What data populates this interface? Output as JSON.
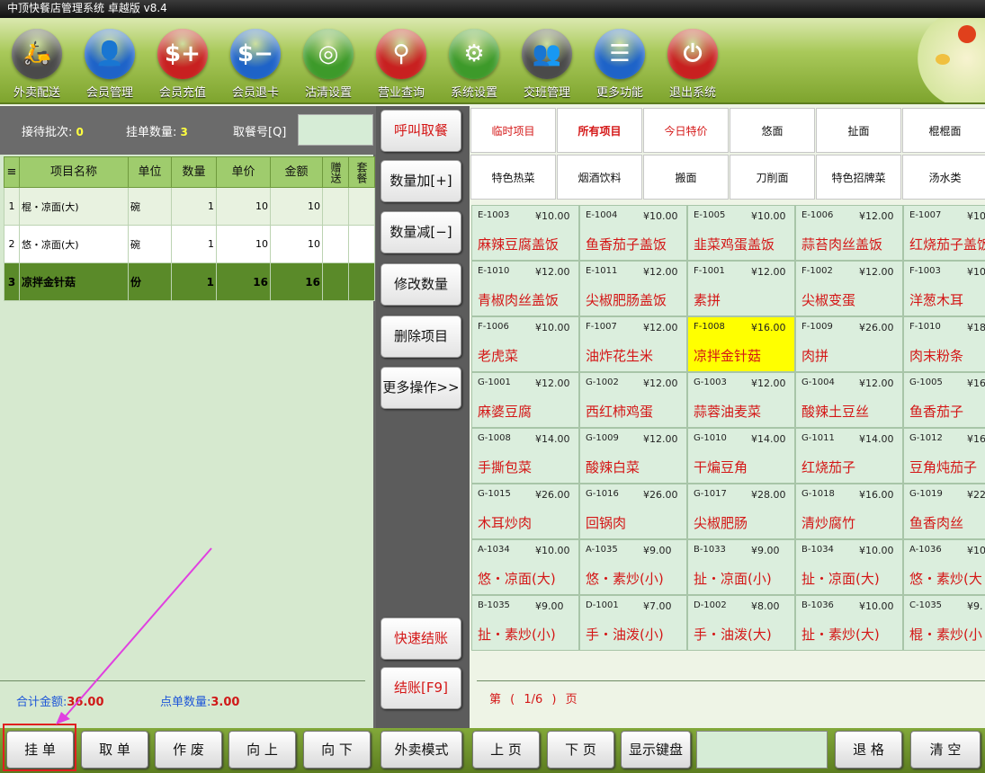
{
  "app": {
    "title": "中顶快餐店管理系统 卓越版 v8.4"
  },
  "toolbar": [
    {
      "label": "外卖配送",
      "icon": "scooter-icon",
      "glyph": "🛵",
      "color": "#4a4a4a"
    },
    {
      "label": "会员管理",
      "icon": "member-icon",
      "glyph": "👤",
      "color": "#1e63c8"
    },
    {
      "label": "会员充值",
      "icon": "recharge-card-icon",
      "glyph": "$+",
      "color": "#c82020"
    },
    {
      "label": "会员退卡",
      "icon": "refund-card-icon",
      "glyph": "$−",
      "color": "#1e63c8"
    },
    {
      "label": "沽清设置",
      "icon": "plate-icon",
      "glyph": "◎",
      "color": "#3d9a2a"
    },
    {
      "label": "营业查询",
      "icon": "magnifier-icon",
      "glyph": "⚲",
      "color": "#c82020"
    },
    {
      "label": "系统设置",
      "icon": "gear-icon",
      "glyph": "⚙",
      "color": "#3d9a2a"
    },
    {
      "label": "交班管理",
      "icon": "handover-icon",
      "glyph": "👥",
      "color": "#4a4a4a"
    },
    {
      "label": "更多功能",
      "icon": "list-icon",
      "glyph": "☰",
      "color": "#1e63c8"
    },
    {
      "label": "退出系统",
      "icon": "power-icon",
      "glyph": "⏻",
      "color": "#c82020"
    }
  ],
  "order": {
    "waiting_label": "接待批次:",
    "waiting_value": "0",
    "hold_label": "挂单数量:",
    "hold_value": "3",
    "pickup_label": "取餐号[Q]",
    "pickup_value": "",
    "columns": [
      "≡",
      "项目名称",
      "单位",
      "数量",
      "单价",
      "金额",
      "赠送",
      "套餐"
    ],
    "rows": [
      {
        "idx": "1",
        "name": "棍・凉面(大)",
        "unit": "碗",
        "qty": "1",
        "price": "10",
        "amount": "10",
        "gift": "",
        "set": ""
      },
      {
        "idx": "2",
        "name": "悠・凉面(大)",
        "unit": "碗",
        "qty": "1",
        "price": "10",
        "amount": "10",
        "gift": "",
        "set": ""
      },
      {
        "idx": "3",
        "name": "凉拌金针菇",
        "unit": "份",
        "qty": "1",
        "price": "16",
        "amount": "16",
        "gift": "",
        "set": ""
      }
    ],
    "selected_row": 2,
    "total_label": "合计金额:",
    "total_value": "36.00",
    "count_label": "点单数量:",
    "count_value": "3.00"
  },
  "actions": {
    "call": "呼叫取餐",
    "qty_plus": "数量加[+]",
    "qty_minus": "数量减[−]",
    "modify_qty": "修改数量",
    "delete_item": "删除项目",
    "more_ops": "更多操作>>",
    "quick_checkout": "快速结账",
    "checkout": "结账[F9]"
  },
  "categories": [
    {
      "label": "临时项目",
      "style": "red"
    },
    {
      "label": "所有项目",
      "style": "act"
    },
    {
      "label": "今日特价",
      "style": "red"
    },
    {
      "label": "悠面",
      "style": ""
    },
    {
      "label": "扯面",
      "style": ""
    },
    {
      "label": "棍棍面",
      "style": ""
    },
    {
      "label": "特色热菜",
      "style": ""
    },
    {
      "label": "烟酒饮料",
      "style": ""
    },
    {
      "label": "搬面",
      "style": ""
    },
    {
      "label": "刀削面",
      "style": ""
    },
    {
      "label": "特色招牌菜",
      "style": ""
    },
    {
      "label": "汤水类",
      "style": ""
    }
  ],
  "menu": [
    {
      "code": "E-1003",
      "price": "¥10.00",
      "name": "麻辣豆腐盖饭"
    },
    {
      "code": "E-1004",
      "price": "¥10.00",
      "name": "鱼香茄子盖饭"
    },
    {
      "code": "E-1005",
      "price": "¥10.00",
      "name": "韭菜鸡蛋盖饭"
    },
    {
      "code": "E-1006",
      "price": "¥12.00",
      "name": "蒜苔肉丝盖饭"
    },
    {
      "code": "E-1007",
      "price": "¥10",
      "name": "红烧茄子盖饭"
    },
    {
      "code": "E-1010",
      "price": "¥12.00",
      "name": "青椒肉丝盖饭"
    },
    {
      "code": "E-1011",
      "price": "¥12.00",
      "name": "尖椒肥肠盖饭"
    },
    {
      "code": "F-1001",
      "price": "¥12.00",
      "name": "素拼"
    },
    {
      "code": "F-1002",
      "price": "¥12.00",
      "name": "尖椒变蛋"
    },
    {
      "code": "F-1003",
      "price": "¥10",
      "name": "洋葱木耳"
    },
    {
      "code": "F-1006",
      "price": "¥10.00",
      "name": "老虎菜"
    },
    {
      "code": "F-1007",
      "price": "¥12.00",
      "name": "油炸花生米"
    },
    {
      "code": "F-1008",
      "price": "¥16.00",
      "name": "凉拌金针菇"
    },
    {
      "code": "F-1009",
      "price": "¥26.00",
      "name": "肉拼"
    },
    {
      "code": "F-1010",
      "price": "¥18",
      "name": "肉末粉条"
    },
    {
      "code": "G-1001",
      "price": "¥12.00",
      "name": "麻婆豆腐"
    },
    {
      "code": "G-1002",
      "price": "¥12.00",
      "name": "西红柿鸡蛋"
    },
    {
      "code": "G-1003",
      "price": "¥12.00",
      "name": "蒜蓉油麦菜"
    },
    {
      "code": "G-1004",
      "price": "¥12.00",
      "name": "酸辣土豆丝"
    },
    {
      "code": "G-1005",
      "price": "¥16",
      "name": "鱼香茄子"
    },
    {
      "code": "G-1008",
      "price": "¥14.00",
      "name": "手撕包菜"
    },
    {
      "code": "G-1009",
      "price": "¥12.00",
      "name": "酸辣白菜"
    },
    {
      "code": "G-1010",
      "price": "¥14.00",
      "name": "干煸豆角"
    },
    {
      "code": "G-1011",
      "price": "¥14.00",
      "name": "红烧茄子"
    },
    {
      "code": "G-1012",
      "price": "¥16",
      "name": "豆角炖茄子"
    },
    {
      "code": "G-1015",
      "price": "¥26.00",
      "name": "木耳炒肉"
    },
    {
      "code": "G-1016",
      "price": "¥26.00",
      "name": "回锅肉"
    },
    {
      "code": "G-1017",
      "price": "¥28.00",
      "name": "尖椒肥肠"
    },
    {
      "code": "G-1018",
      "price": "¥16.00",
      "name": "清炒腐竹"
    },
    {
      "code": "G-1019",
      "price": "¥22",
      "name": "鱼香肉丝"
    },
    {
      "code": "A-1034",
      "price": "¥10.00",
      "name": "悠・凉面(大)"
    },
    {
      "code": "A-1035",
      "price": "¥9.00",
      "name": "悠・素炒(小)"
    },
    {
      "code": "B-1033",
      "price": "¥9.00",
      "name": "扯・凉面(小)"
    },
    {
      "code": "B-1034",
      "price": "¥10.00",
      "name": "扯・凉面(大)"
    },
    {
      "code": "A-1036",
      "price": "¥10",
      "name": "悠・素炒(大"
    },
    {
      "code": "B-1035",
      "price": "¥9.00",
      "name": "扯・素炒(小)"
    },
    {
      "code": "D-1001",
      "price": "¥7.00",
      "name": "手・油泼(小)"
    },
    {
      "code": "D-1002",
      "price": "¥8.00",
      "name": "手・油泼(大)"
    },
    {
      "code": "B-1036",
      "price": "¥10.00",
      "name": "扯・素炒(大)"
    },
    {
      "code": "C-1035",
      "price": "¥9.",
      "name": "棍・素炒(小"
    }
  ],
  "highlighted_item": 12,
  "pagination": {
    "text": "第 ( 1/6 ) 页"
  },
  "bottom": {
    "hold": "挂 单",
    "retrieve": "取 单",
    "void": "作 废",
    "up": "向 上",
    "down": "向 下",
    "takeout_mode": "外卖模式",
    "prev_page": "上 页",
    "next_page": "下 页",
    "show_keyboard": "显示键盘",
    "input_value": "",
    "backspace": "退 格",
    "clear": "清 空"
  },
  "colors": {
    "accent_red": "#d41616",
    "highlight": "#ffff00",
    "toolbar_green": "#7ea42e",
    "annotation_arrow": "#e040e0"
  }
}
